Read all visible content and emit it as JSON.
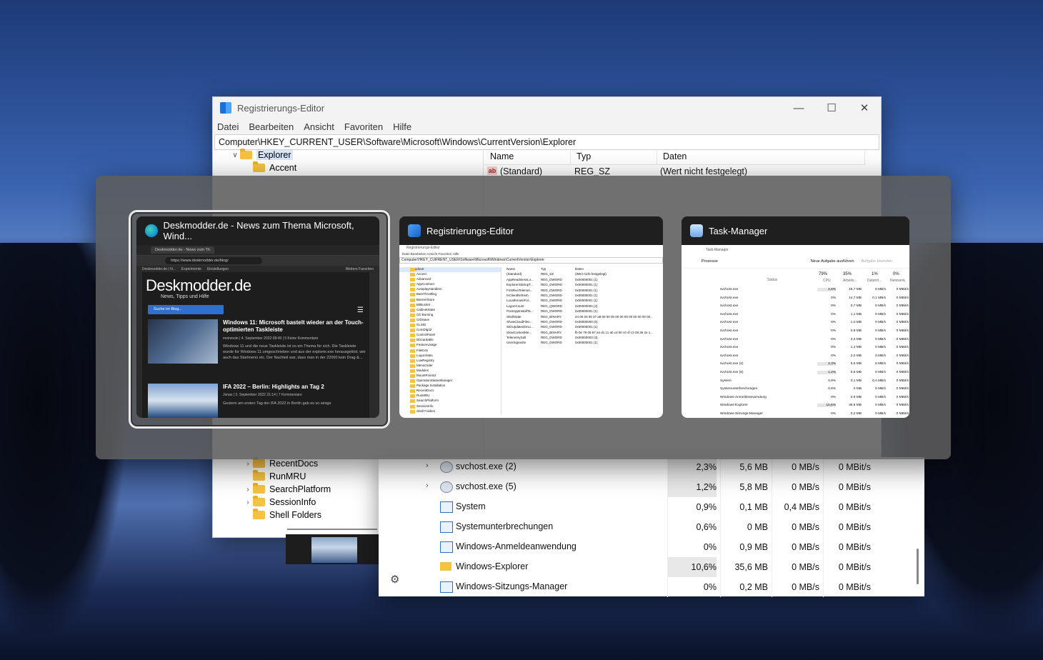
{
  "registry": {
    "title": "Registrierungs-Editor",
    "menu": [
      "Datei",
      "Bearbeiten",
      "Ansicht",
      "Favoriten",
      "Hilfe"
    ],
    "address": "Computer\\HKEY_CURRENT_USER\\Software\\Microsoft\\Windows\\CurrentVersion\\Explorer",
    "tree_top": [
      "Explorer",
      "Accent"
    ],
    "tree_bottom": [
      "RecentDocs",
      "RunMRU",
      "SearchPlatform",
      "SessionInfo",
      "Shell Folders"
    ],
    "columns": [
      "Name",
      "Typ",
      "Daten"
    ],
    "first_value": {
      "name": "(Standard)",
      "type": "REG_SZ",
      "data": "(Wert nicht festgelegt)"
    }
  },
  "taskmanager": {
    "rows": [
      {
        "name": "svchost.exe (2)",
        "cpu": "2,3%",
        "mem": "5,6 MB",
        "disk": "0 MB/s",
        "net": "0 MBit/s",
        "expand": true,
        "icon": "gear",
        "cpu_hi": true
      },
      {
        "name": "svchost.exe (5)",
        "cpu": "1,2%",
        "mem": "5,8 MB",
        "disk": "0 MB/s",
        "net": "0 MBit/s",
        "expand": true,
        "icon": "gear",
        "cpu_hi": true
      },
      {
        "name": "System",
        "cpu": "0,9%",
        "mem": "0,1 MB",
        "disk": "0,4 MB/s",
        "net": "0 MBit/s",
        "expand": false,
        "icon": "win",
        "cpu_hi": false
      },
      {
        "name": "Systemunterbrechungen",
        "cpu": "0,6%",
        "mem": "0 MB",
        "disk": "0 MB/s",
        "net": "0 MBit/s",
        "expand": false,
        "icon": "win",
        "cpu_hi": false
      },
      {
        "name": "Windows-Anmeldeanwendung",
        "cpu": "0%",
        "mem": "0,9 MB",
        "disk": "0 MB/s",
        "net": "0 MBit/s",
        "expand": false,
        "icon": "win",
        "cpu_hi": false
      },
      {
        "name": "Windows-Explorer",
        "cpu": "10,6%",
        "mem": "35,6 MB",
        "disk": "0 MB/s",
        "net": "0 MBit/s",
        "expand": false,
        "icon": "folder",
        "cpu_hi": true
      },
      {
        "name": "Windows-Sitzungs-Manager",
        "cpu": "0%",
        "mem": "0,2 MB",
        "disk": "0 MB/s",
        "net": "0 MBit/s",
        "expand": false,
        "icon": "win",
        "cpu_hi": false
      }
    ]
  },
  "alttab": {
    "cards": [
      {
        "title": "Deskmodder.de - News zum Thema Microsoft, Wind...",
        "icon": "edge-icon"
      },
      {
        "title": "Registrierungs-Editor",
        "icon": "regedit-icon"
      },
      {
        "title": "Task-Manager",
        "icon": "taskmanager-icon"
      }
    ],
    "edge_thumb": {
      "tab": "Deskmodder.de - News zum Th",
      "url": "https://www.deskmodder.de/blog/",
      "favorites": [
        "Deskmodder.de | N...",
        "Experimente",
        "Einstellungen",
        "Weitere Favoriten"
      ],
      "logo": "Deskmodder.de",
      "tagline": "News, Tipps und Hilfe",
      "search": "Suche im Blog...",
      "articles": [
        {
          "title": "Windows 11: Microsoft bastelt wieder an der Touch-optimierten Taskleiste",
          "meta": "moinmoin | 4. September 2022 08:49 | 5 Keine Kommentare",
          "text": "Windows 11 und die neue Taskleiste ist so ein Thema für sich. Die Taskleiste wurde für Windows 11 umgeschrieben und aus der explorer.exe herausgelöst, wie auch das Startmenü etc. Der Nachteil war, dass man in der 22000 kein Drag &..."
        },
        {
          "title": "IFA 2022 – Berlin: Highlights an Tag 2",
          "meta": "Jonas | 3. September 2022 21:14 | 7 Kommentare",
          "text": "Gestern am ersten Tag der IFA 2022 in Berlin gab es so einige"
        }
      ]
    },
    "reg_thumb": {
      "title": "Registrierungs-Editor",
      "menu": "Datei   Bearbeiten   Ansicht   Favoriten   Hilfe",
      "address": "Computer\\HKEY_CURRENT_USER\\Software\\Microsoft\\Windows\\CurrentVersion\\Explorer",
      "tree": [
        "Explorer",
        "Accent",
        "Advanced",
        "AppContract",
        "AutoplayHandlers",
        "BamThrottling",
        "BannerStore",
        "BitBucket",
        "CabinetState",
        "CD Burning",
        "CIDSave",
        "CLSID",
        "ComDlg32",
        "ControlPanel",
        "Discardable",
        "FeatureUsage",
        "FileExts",
        "LogonStats",
        "LowRegistry",
        "MenuOrder",
        "Modules",
        "MountPoints2",
        "OperationStatusManager",
        "Package Installation",
        "RecentDocs",
        "RunMRU",
        "SearchPlatform",
        "SessionInfo",
        "Shell Folders"
      ],
      "header": [
        "Name",
        "Typ",
        "Daten"
      ],
      "values": [
        [
          "(Standard)",
          "REG_SZ",
          "(Wert nicht festgelegt)"
        ],
        [
          "AppReadinessLo...",
          "REG_DWORD",
          "0x00000001 (1)"
        ],
        [
          "ExplorerStartupT...",
          "REG_DWORD",
          "0x00000001 (1)"
        ],
        [
          "FirstRunTelemet...",
          "REG_DWORD",
          "0x00000001 (1)"
        ],
        [
          "IsClientRefresh",
          "REG_DWORD",
          "0x00000001 (1)"
        ],
        [
          "LocalKnownFol...",
          "REG_DWORD",
          "0x00000001 (1)"
        ],
        [
          "LogonCount",
          "REG_QWORD",
          "0x00000004 (4)"
        ],
        [
          "PostAppInstallTa...",
          "REG_DWORD",
          "0x00000001 (1)"
        ],
        [
          "ShellState",
          "REG_BINARY",
          "24 00 00 00 37 a8 00 00 00 00 00 00 00 00 00 00 00..."
        ],
        [
          "ShowCloudFiles...",
          "REG_DWORD",
          "0x00000000 (0)"
        ],
        [
          "SIDUpdatedOnLi...",
          "REG_DWORD",
          "0x00000001 (1)"
        ],
        [
          "SlowContextMe...",
          "REG_BINARY",
          "fb 0e 79 09 67 a4 d1 11 ab cd 00 c0 4f c3 09 36 2e 1..."
        ],
        [
          "TelemetrySalt",
          "REG_DWORD",
          "0x00000003 (3)"
        ],
        [
          "UserSignedIn",
          "REG_DWORD",
          "0x00000001 (1)"
        ]
      ]
    },
    "tm_thumb": {
      "title": "Task-Manager",
      "section": "Prozesse",
      "new_task": "Neue Aufgabe ausführen",
      "end_task": "Aufgabe beenden",
      "hdr": {
        "status": "Status",
        "cpu": "79%",
        "mem": "35%",
        "disk": "1%",
        "net": "0%",
        "cpu_l": "CPU",
        "mem_l": "Arbeits...",
        "disk_l": "Datentr...",
        "net_l": "Netzwerk"
      },
      "rows": [
        [
          "svchost.exe",
          "2,6%",
          "18,7 MB",
          "0 MB/s",
          "0 MBit/s"
        ],
        [
          "svchost.exe",
          "0%",
          "14,7 MB",
          "0,1 MB/s",
          "0 MBit/s"
        ],
        [
          "svchost.exe",
          "0%",
          "0,7 MB",
          "0 MB/s",
          "0 MBit/s"
        ],
        [
          "svchost.exe",
          "0%",
          "1,1 MB",
          "0 MB/s",
          "0 MBit/s"
        ],
        [
          "svchost.exe",
          "0%",
          "1,0 MB",
          "0 MB/s",
          "0 MBit/s"
        ],
        [
          "svchost.exe",
          "0%",
          "0,9 MB",
          "0 MB/s",
          "0 MBit/s"
        ],
        [
          "svchost.exe",
          "0%",
          "3,3 MB",
          "0 MB/s",
          "0 MBit/s"
        ],
        [
          "svchost.exe",
          "0%",
          "1,4 MB",
          "0 MB/s",
          "0 MBit/s"
        ],
        [
          "svchost.exe",
          "0%",
          "2,0 MB",
          "0 MB/s",
          "0 MBit/s"
        ],
        [
          "svchost.exe (2)",
          "2,3%",
          "5,6 MB",
          "0 MB/s",
          "0 MBit/s"
        ],
        [
          "svchost.exe (5)",
          "1,2%",
          "5,8 MB",
          "0 MB/s",
          "0 MBit/s"
        ],
        [
          "System",
          "0,9%",
          "0,1 MB",
          "0,4 MB/s",
          "0 MBit/s"
        ],
        [
          "Systemunterbrechungen",
          "0,6%",
          "0 MB",
          "0 MB/s",
          "0 MBit/s"
        ],
        [
          "Windows-Anmeldeanwendung",
          "0%",
          "0,9 MB",
          "0 MB/s",
          "0 MBit/s"
        ],
        [
          "Windows-Explorer",
          "10,6%",
          "35,6 MB",
          "0 MB/s",
          "0 MBit/s"
        ],
        [
          "Windows-Sitzungs-Manager",
          "0%",
          "0,2 MB",
          "0 MB/s",
          "0 MBit/s"
        ]
      ]
    }
  }
}
